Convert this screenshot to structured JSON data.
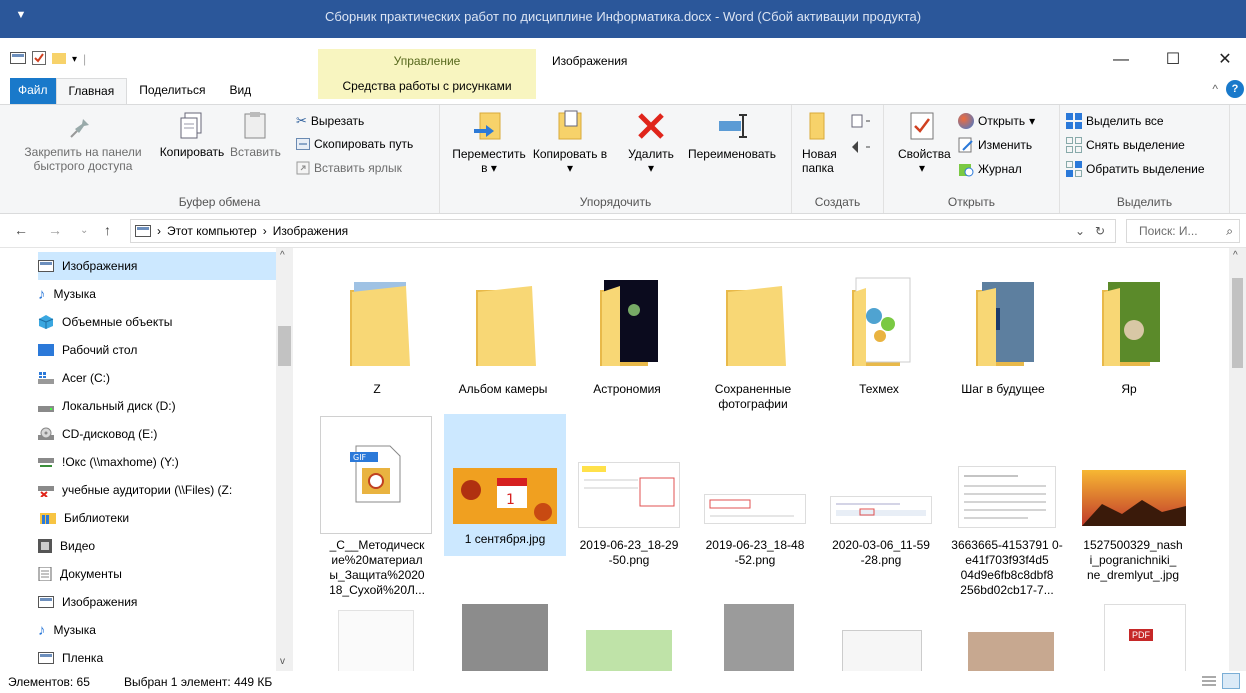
{
  "window": {
    "title": "Сборник практических работ по дисциплине  Информатика.docx - Word (Сбой активации продукта)"
  },
  "ribbon_tabs": {
    "context_group": "Управление",
    "context_tab": "Средства работы с рисунками",
    "location_title": "Изображения",
    "tabs": [
      {
        "label": "Файл"
      },
      {
        "label": "Главная"
      },
      {
        "label": "Поделиться"
      },
      {
        "label": "Вид"
      }
    ]
  },
  "ribbon": {
    "clipboard": {
      "label": "Буфер обмена",
      "pin": "Закрепить на панели быстрого доступа",
      "copy": "Копировать",
      "paste": "Вставить",
      "cut": "Вырезать",
      "copy_path": "Скопировать путь",
      "paste_shortcut": "Вставить ярлык"
    },
    "organize": {
      "label": "Упорядочить",
      "move": "Переместить в",
      "copy_to": "Копировать в",
      "delete": "Удалить",
      "rename": "Переименовать"
    },
    "create": {
      "label": "Создать",
      "new_folder": "Новая папка"
    },
    "open": {
      "label": "Открыть",
      "properties": "Свойства",
      "open": "Открыть",
      "edit": "Изменить",
      "history": "Журнал"
    },
    "select": {
      "label": "Выделить",
      "all": "Выделить все",
      "none": "Снять выделение",
      "invert": "Обратить выделение"
    }
  },
  "address": {
    "path": [
      "Этот компьютер",
      "Изображения"
    ],
    "search_placeholder": "Поиск: И..."
  },
  "nav": [
    {
      "label": "Изображения",
      "icon": "pictures-icon"
    },
    {
      "label": "Музыка",
      "icon": "music-icon"
    },
    {
      "label": "Объемные объекты",
      "icon": "3d-objects-icon"
    },
    {
      "label": "Рабочий стол",
      "icon": "desktop-icon"
    },
    {
      "label": "Acer (C:)",
      "icon": "windows-drive-icon"
    },
    {
      "label": "Локальный диск (D:)",
      "icon": "drive-icon"
    },
    {
      "label": "CD-дисковод (E:)",
      "icon": "cd-drive-icon"
    },
    {
      "label": "!Окс (\\\\maxhome) (Y:)",
      "icon": "network-drive-icon"
    },
    {
      "label": "учебные аудитории (\\\\Files) (Z:",
      "icon": "disconnected-drive-icon"
    },
    {
      "label": "Библиотеки",
      "icon": "libraries-icon"
    },
    {
      "label": "Видео",
      "icon": "video-icon"
    },
    {
      "label": "Документы",
      "icon": "documents-icon"
    },
    {
      "label": "Изображения",
      "icon": "pictures-icon"
    },
    {
      "label": "Музыка",
      "icon": "music-icon"
    },
    {
      "label": "Пленка",
      "icon": "film-icon"
    }
  ],
  "folders": [
    {
      "name": "Z"
    },
    {
      "name": "Альбом камеры"
    },
    {
      "name": "Астрономия"
    },
    {
      "name": "Сохраненные фотографии"
    },
    {
      "name": "Техмех"
    },
    {
      "name": "Шаг в будущее"
    },
    {
      "name": "Яр"
    }
  ],
  "files": [
    {
      "name": "_C__Методическ ие%20материал ы_Защита%2020 18_Сухой%20Л...",
      "icon": "gif-file-icon"
    },
    {
      "name": "1 сентября.jpg",
      "icon": "photo-thumbnail"
    },
    {
      "name": "2019-06-23_18-29 -50.png",
      "icon": "screenshot-thumbnail"
    },
    {
      "name": "2019-06-23_18-48 -52.png",
      "icon": "screenshot-thumbnail"
    },
    {
      "name": "2020-03-06_11-59 -28.png",
      "icon": "screenshot-thumbnail"
    },
    {
      "name": "3663665-4153791 0-e41f703f93f4d5 04d9e6fb8c8dbf8 256bd02cb17-7...",
      "icon": "document-thumbnail"
    },
    {
      "name": "1527500329_nash i_pogranichniki_ ne_dremlyut_.jpg",
      "icon": "photo-thumbnail"
    }
  ],
  "status": {
    "count": "Элементов: 65",
    "selected": "Выбран 1 элемент: 449 КБ"
  }
}
